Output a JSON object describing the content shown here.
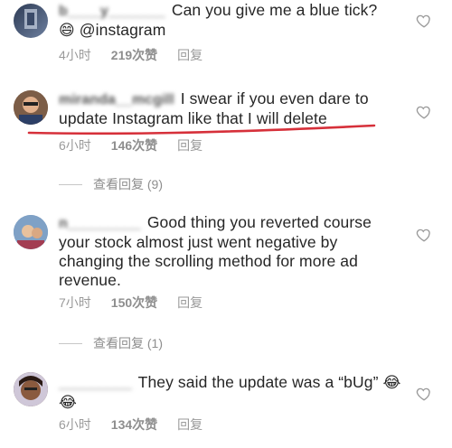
{
  "comments": [
    {
      "username": "b____y_______",
      "text": "Can you give me a blue tick?",
      "text2": "@instagram",
      "emoji": "😄",
      "time": "4小时",
      "likes": "219次赞",
      "reply_label": "回复"
    },
    {
      "username": "miranda__mcgill",
      "text": "I swear if you even dare to update Instagram like that I will delete",
      "time": "6小时",
      "likes": "146次赞",
      "reply_label": "回复",
      "view_replies": "查看回复 (9)"
    },
    {
      "username": "n_________",
      "text": "Good thing you reverted course your stock almost just went negative by changing the scrolling method for more ad revenue.",
      "time": "7小时",
      "likes": "150次赞",
      "reply_label": "回复",
      "view_replies": "查看回复 (1)"
    },
    {
      "username": "_________",
      "text": "They said the update was a “bUg”",
      "emoji": "😂😂",
      "time": "6小时",
      "likes": "134次赞",
      "reply_label": "回复"
    }
  ],
  "colors": {
    "underline": "#d6303a",
    "meta_text": "#9a9a9a"
  }
}
